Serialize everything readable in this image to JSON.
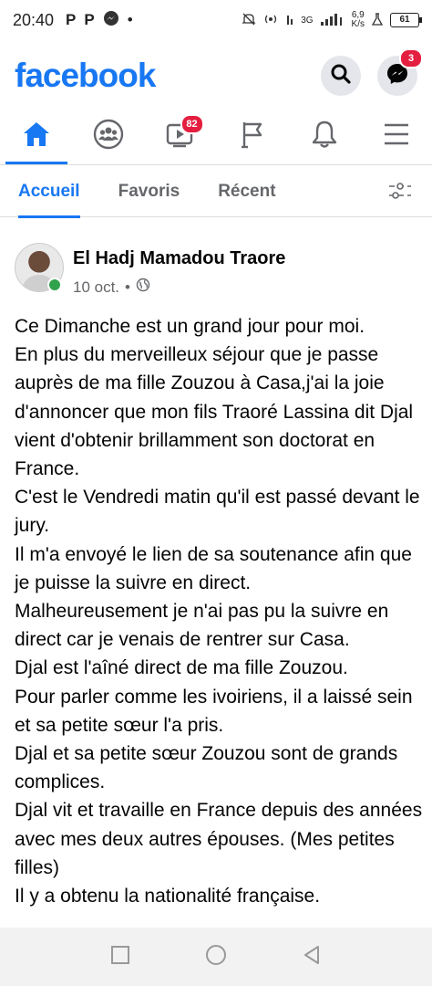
{
  "status_bar": {
    "time": "20:40",
    "notif_p1": "P",
    "notif_p2": "P",
    "dot": "•",
    "net_3g": "3G",
    "speed_value": "6,9",
    "speed_unit": "K/s",
    "battery": "61"
  },
  "header": {
    "logo": "facebook",
    "messenger_badge": "3"
  },
  "nav": {
    "video_badge": "82"
  },
  "tabs": [
    {
      "label": "Accueil"
    },
    {
      "label": "Favoris"
    },
    {
      "label": "Récent"
    }
  ],
  "post": {
    "author": "El Hadj Mamadou Traore",
    "date": "10 oct.",
    "separator": "•",
    "text": "Ce Dimanche est un grand jour pour moi.\nEn plus du merveilleux séjour que je passe auprès de ma fille Zouzou à Casa,j'ai la joie d'annoncer  que mon fils Traoré Lassina dit Djal vient d'obtenir brillamment son doctorat en France.\nC'est le Vendredi matin qu'il est passé devant le jury.\nIl m'a envoyé le lien de sa soutenance afin que je puisse la suivre en direct.\nMalheureusement je n'ai pas pu la  suivre en direct   car je venais de rentrer sur Casa.\nDjal est l'aîné direct de ma fille Zouzou.\nPour parler comme les ivoiriens, il a laissé sein et sa petite sœur l'a pris.\nDjal et sa petite sœur Zouzou sont de grands complices.\nDjal vit et travaille en France depuis des années avec mes deux autres épouses. (Mes petites filles)\nIl y a obtenu la nationalité française."
  },
  "colors": {
    "brand": "#1877f2",
    "badge": "#e41e3f",
    "online": "#31a24c"
  }
}
